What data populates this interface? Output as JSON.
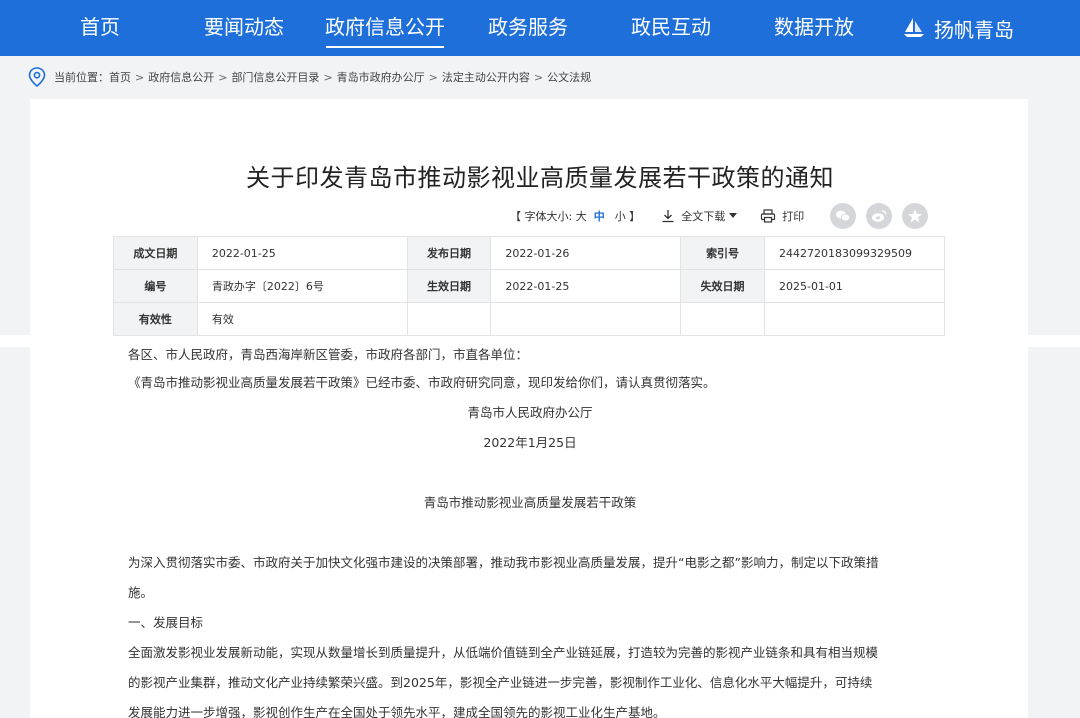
{
  "nav": {
    "items": [
      "首页",
      "要闻动态",
      "政府信息公开",
      "政务服务",
      "政民互动",
      "数据开放"
    ],
    "active_index": 2,
    "brand": "扬帆青岛"
  },
  "breadcrumb": {
    "prefix": "当前位置：",
    "items": [
      "首页",
      "政府信息公开",
      "部门信息公开目录",
      "青岛市政府办公厅",
      "法定主动公开内容",
      "公文法规"
    ],
    "separator": ">"
  },
  "document": {
    "title": "关于印发青岛市推动影视业高质量发展若干政策的通知",
    "font_size_label": "【 字体大小: 大",
    "font_size_mid": "中",
    "font_size_small": "小 】",
    "download_label": "全文下载",
    "print_label": "打印",
    "share_icons": [
      "wechat-icon",
      "weibo-icon",
      "star-icon"
    ]
  },
  "meta": {
    "row1": {
      "k1": "成文日期",
      "v1": "2022-01-25",
      "k2": "发布日期",
      "v2": "2022-01-26",
      "k3": "索引号",
      "v3": "2442720183099329509"
    },
    "row2": {
      "k1": "编号",
      "v1": "青政办字〔2022〕6号",
      "k2": "生效日期",
      "v2": "2022-01-25",
      "k3": "失效日期",
      "v3": "2025-01-01"
    },
    "row3": {
      "k1": "有效性",
      "v1": "有效"
    }
  },
  "body": {
    "addressee": "各区、市人民政府，青岛西海岸新区管委，市政府各部门，市直各单位：",
    "notice": "《青岛市推动影视业高质量发展若干政策》已经市委、市政府研究同意，现印发给你们，请认真贯彻落实。",
    "issuer": "青岛市人民政府办公厅",
    "date": "2022年1月25日",
    "policy_title": "青岛市推动影视业高质量发展若干政策",
    "intro_1": "为深入贯彻落实市委、市政府关于加快文化强市建设的决策部署，推动我市影视业高质量发展，提升“电影之都”影响力，制定以下政策措",
    "intro_2": "施。",
    "section_1": "一、发展目标",
    "goal_1": "全面激发影视业发展新动能，实现从数量增长到质量提升，从低端价值链到全产业链延展，打造较为完善的影视产业链条和具有相当规模",
    "goal_2": "的影视产业集群，推动文化产业持续繁荣兴盛。到2025年，影视全产业链进一步完善，影视制作工业化、信息化水平大幅提升，可持续",
    "goal_3": "发展能力进一步增强，影视创作生产在全国处于领先水平，建成全国领先的影视工业化生产基地。"
  },
  "colors": {
    "nav_bg": "#1e6fd9",
    "accent": "#1e6fd9",
    "page_bg": "#f2f3f5"
  }
}
